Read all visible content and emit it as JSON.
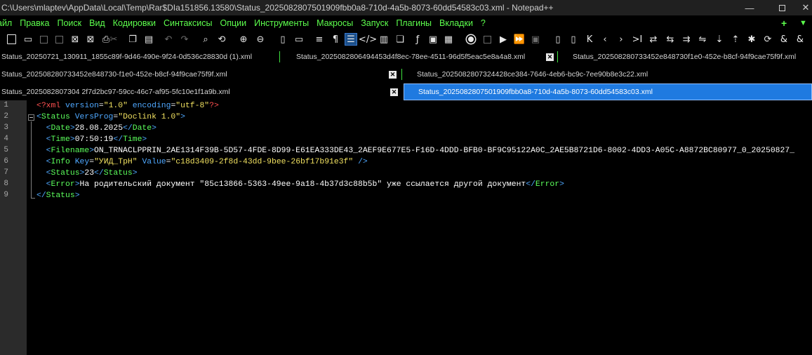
{
  "window": {
    "title": "C:\\Users\\mlaptev\\AppData\\Local\\Temp\\Rar$DIa151856.13580\\Status_2025082807501909fbb0a8-710d-4a5b-8073-60dd54583c03.xml - Notepad++",
    "minimize": "—",
    "close": "✕"
  },
  "menu": {
    "items": [
      "айл",
      "Правка",
      "Поиск",
      "Вид",
      "Кодировки",
      "Синтаксисы",
      "Опции",
      "Инструменты",
      "Макросы",
      "Запуск",
      "Плагины",
      "Вкладки",
      "?"
    ],
    "add": "+",
    "dropdown": "▼"
  },
  "toolbar": {
    "icons": [
      "new-file-icon",
      "open-folder-icon",
      "save-icon",
      "save-all-icon",
      "close-icon",
      "close-all-icon",
      "print-icon",
      "cut-icon",
      "copy-icon",
      "paste-icon",
      "undo-icon",
      "redo-icon",
      "find-icon",
      "replace-icon",
      "zoom-in-icon",
      "zoom-out-icon",
      "sync-vertical-icon",
      "sync-horizontal-icon",
      "word-wrap-icon",
      "show-all-chars-icon",
      "indent-guide-icon",
      "xml-tags-icon",
      "document-map-icon",
      "document-list-icon",
      "function-list-icon",
      "monitor-icon",
      "folder-workspace-icon",
      "record-macro-icon",
      "stop-record-icon",
      "play-macro-icon",
      "run-macro-multiple-icon",
      "save-macro-icon"
    ]
  },
  "tabs": [
    {
      "label": "Status_20250721_130911_1855c89f-9d46-490e-9f24-0d536c28830d (1).xml",
      "active": false
    },
    {
      "label": "Status_2025082806494453d4f8ec-78ee-4511-96d5f5eac5e8a4a8.xml",
      "active": false
    },
    {
      "label": "Status_202508280733452e848730f1e0-452e-b8cf-94f9cae75f9f.xml",
      "active": false
    },
    {
      "label": "Status_202508280733452e848730-f1e0-452e-b8cf-94f9cae75f9f.xml",
      "active": false
    },
    {
      "label": "Status_2025082807324428ce384-7646-4eb6-bc9c-7ee90b8e3c22.xml",
      "active": false
    },
    {
      "label": "Status_2025082807304 2f7d2bc97-59cc-46c7-af95-5fc10e1f1a9b.xml",
      "active": false
    },
    {
      "label": "Status_2025082807501909fbb0a8-710d-4a5b-8073-60dd54583c03.xml",
      "active": true
    }
  ],
  "tab_close_glyph": "✕",
  "editor": {
    "line_numbers": [
      "1",
      "2",
      "3",
      "4",
      "5",
      "6",
      "7",
      "8",
      "9"
    ],
    "xml": {
      "pi_open": "<?xml",
      "version_attr": "version",
      "version_val": "\"1.0\"",
      "encoding_attr": "encoding",
      "encoding_val": "\"utf-8\"",
      "pi_close": "?>",
      "status_tag": "Status",
      "versprog_attr": "VersProg",
      "versprog_val": "\"Doclink 1.0\"",
      "date_tag": "Date",
      "date_value": "28.08.2025",
      "time_tag": "Time",
      "time_value": "07:50:19",
      "filename_tag": "Filename",
      "filename_value": "ON_TRNACLPPRIN_2AE1314F39B-5D57-4FDE-8D99-E61EA333DE43_2AEF9E677E5-F16D-4DDD-BFB0-BF9C95122A0C_2AE5B8721D6-8002-4DD3-A05C-A8872BC80977_0_20250827_",
      "info_tag": "Info",
      "key_attr": "Key",
      "key_val": "\"УИД_ТрН\"",
      "value_attr": "Value",
      "value_val": "\"c18d3409-2f8d-43dd-9bee-26bf17b91e3f\"",
      "selfclose": "/>",
      "status_code_tag": "Status",
      "status_code_value": "23",
      "error_tag": "Error",
      "error_value": "На родительский документ \"85c13866-5363-49ee-9a18-4b37d3c88b5b\" уже ссылается другой документ"
    }
  },
  "colors": {
    "menu_text": "#5dff4d",
    "active_tab": "#1f7ae0",
    "xml_tag": "#5cff5c",
    "xml_attr": "#4fa8ff",
    "xml_value": "#f0e060",
    "xml_pi": "#ff5050"
  }
}
